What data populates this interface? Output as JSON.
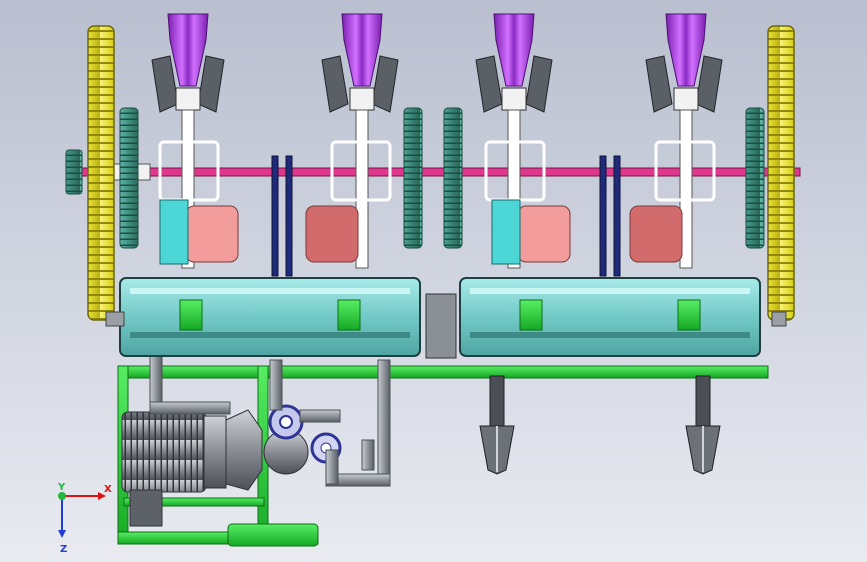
{
  "viewport": {
    "background_top": "#b9bfcf",
    "background_bottom": "#e9ebf1"
  },
  "colors": {
    "gear_yellow": "#e8e23a",
    "gear_teal": "#3f8f80",
    "rotor_purple": "#b13ce6",
    "box_cyan": "#7fd3d0",
    "frame_green": "#2bd63b",
    "shaft_pink": "#e0378e",
    "plate_salmon": "#e98585",
    "motor_gray": "#7b7f86",
    "pipe_gray": "#9aa0a6"
  },
  "icons": {
    "axis_triad": "coordinate-axis-triad-icon"
  },
  "triad": {
    "x_label": "X",
    "y_label": "Y",
    "z_label": "Z"
  }
}
